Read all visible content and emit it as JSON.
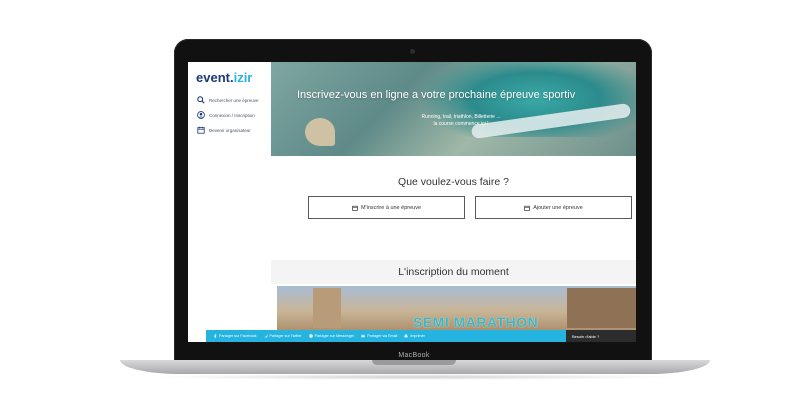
{
  "device": {
    "label": "MacBook"
  },
  "sidebar": {
    "logo": {
      "part1": "event.",
      "part2": "izir"
    },
    "items": [
      {
        "label": "Rechercher une épreuve",
        "icon": "search-icon"
      },
      {
        "label": "Connexion / Inscription",
        "icon": "user-icon"
      },
      {
        "label": "Devenir organisateur",
        "icon": "calendar-icon"
      }
    ]
  },
  "hero": {
    "title": "Inscrivez-vous en ligne a votre prochaine épreuve sportiv",
    "subtitle_line1": "Running, trail, triathlon, Billetterie ...",
    "subtitle_line2": "la course commence ici !"
  },
  "actions": {
    "question": "Que voulez-vous faire ?",
    "register": "M'inscrire à une épreuve",
    "add": "Ajouter une épreuve"
  },
  "featured": {
    "heading": "L'inscription du moment",
    "event_title": "SEMI MARATHON"
  },
  "share_bar": {
    "items": [
      {
        "label": "Partager sur Facebook",
        "icon": "facebook-icon"
      },
      {
        "label": "Partager sur Twitter",
        "icon": "twitter-icon"
      },
      {
        "label": "Partager sur Messenger",
        "icon": "messenger-icon"
      },
      {
        "label": "Partager via Email",
        "icon": "email-icon"
      },
      {
        "label": "Imprimer",
        "icon": "print-icon"
      }
    ],
    "help": "Besoin d'aide ?"
  },
  "colors": {
    "brand_navy": "#1c3a78",
    "brand_cyan": "#2ab3e3",
    "share_bar": "#25b3e0"
  }
}
